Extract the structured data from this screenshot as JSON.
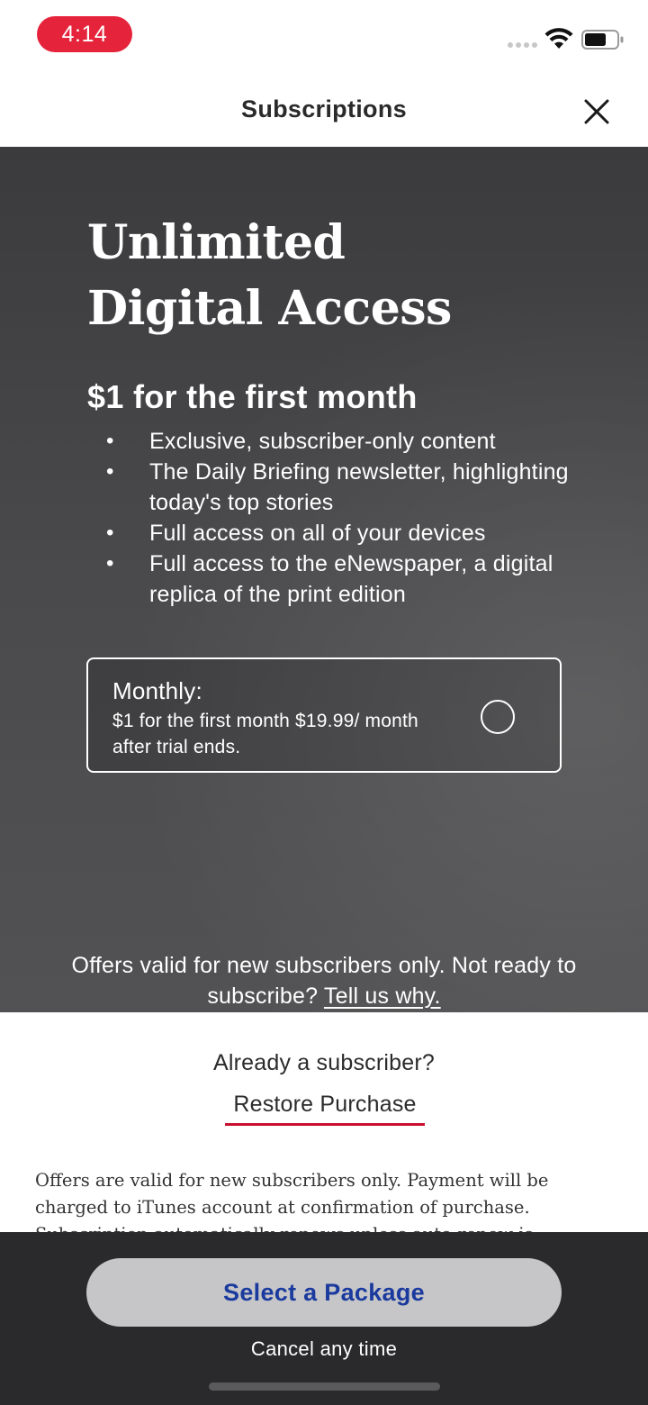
{
  "status_bar": {
    "time": "4:14",
    "icons": [
      "signal-dots-icon",
      "wifi-icon",
      "battery-icon"
    ]
  },
  "header": {
    "title": "Subscriptions",
    "close_icon": "close-icon"
  },
  "hero": {
    "headline_line1": "Unlimited",
    "headline_line2": "Digital Access",
    "price_heading": "$1 for the first month",
    "features": [
      "Exclusive, subscriber-only content",
      "The Daily Briefing newsletter, highlighting today's top stories",
      "Full access on all of your devices",
      "Full access to the eNewspaper, a digital replica of the print edition"
    ],
    "plan": {
      "name": "Monthly:",
      "description": "$1 for the first month $19.99/ month after trial ends.",
      "selected": false
    },
    "offer_note_text": "Offers valid for new subscribers only. Not ready to subscribe?",
    "offer_note_link": "Tell us why."
  },
  "subscriber": {
    "already_label": "Already a subscriber?",
    "restore_link": "Restore Purchase",
    "legal_text": "Offers are valid for new subscribers only. Payment will be charged to iTunes account at confirmation of purchase. Subscription automatically renews unless auto-renew is"
  },
  "bottom_bar": {
    "cta_label": "Select a Package",
    "cancel_note": "Cancel any time"
  },
  "colors": {
    "time_pill": "#e5243b",
    "hero_background": "#474749",
    "restore_underline": "#c8102e",
    "cta_background": "#c6c6c8",
    "cta_text": "#1a3a9e",
    "bottom_bar": "#2a2a2c"
  }
}
